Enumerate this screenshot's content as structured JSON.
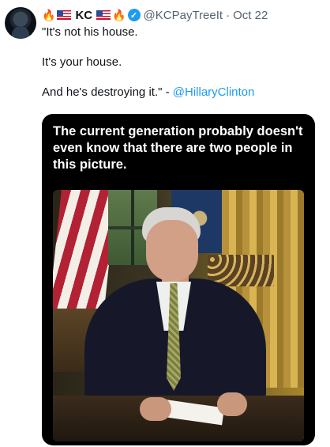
{
  "tweet": {
    "author": {
      "display_name": "KC",
      "emoji_before": "🔥",
      "emoji_after": "🔥",
      "handle": "@KCPayTreeIt",
      "verified": true
    },
    "timestamp": "Oct 22",
    "separator": "·",
    "lines": [
      "\"It's not his house.",
      "It's your house.",
      "And he's destroying it.\" - "
    ],
    "mention": "@HillaryClinton"
  },
  "media": {
    "caption": "The current generation probably doesn't even know that there are two people in this picture."
  },
  "colors": {
    "accent": "#1d9bf0",
    "muted_text": "#536471",
    "text": "#0f1419"
  },
  "icons": {
    "verified": "verified-badge-icon",
    "flag": "us-flag-icon",
    "fire": "fire-emoji-icon"
  }
}
